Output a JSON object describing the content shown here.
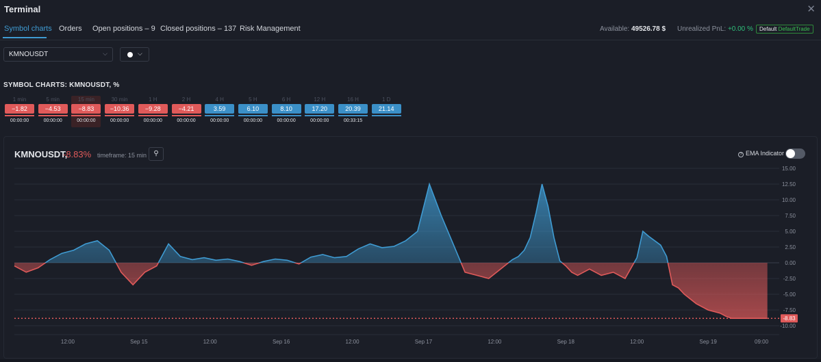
{
  "window": {
    "title": "Terminal",
    "close_icon": "close-icon"
  },
  "tabs": [
    {
      "label": "Symbol charts"
    },
    {
      "label": "Orders"
    },
    {
      "label": "Open positions – 9"
    },
    {
      "label": "Closed positions – 137"
    },
    {
      "label": "Risk Management"
    }
  ],
  "account": {
    "available_label": "Available:",
    "available_value": "49526.78 $",
    "pnl_label": "Unrealized PnL:",
    "pnl_value": "+0.00 %",
    "badge_prefix": "Default",
    "badge_name": "DefaultTrade"
  },
  "symbol_select": {
    "value": "KMNOUSDT"
  },
  "color_select": {
    "value": "white"
  },
  "section_title": "SYMBOL CHARTS: KMNOUSDT, %",
  "timeframes": [
    {
      "label": "1 min",
      "value": "−1.82",
      "time": "00:00:00",
      "sign": "neg"
    },
    {
      "label": "5 min",
      "value": "−4.53",
      "time": "00:00:00",
      "sign": "neg"
    },
    {
      "label": "15 min",
      "value": "−8.83",
      "time": "00:00:00",
      "sign": "neg",
      "selected": true
    },
    {
      "label": "30 min",
      "value": "−10.36",
      "time": "00:00:00",
      "sign": "neg"
    },
    {
      "label": "1 H",
      "value": "−9.28",
      "time": "00:00:00",
      "sign": "neg"
    },
    {
      "label": "2 H",
      "value": "−4.21",
      "time": "00:00:00",
      "sign": "neg"
    },
    {
      "label": "4 H",
      "value": "3.59",
      "time": "00:00:00",
      "sign": "pos"
    },
    {
      "label": "5 H",
      "value": "6.10",
      "time": "00:00:00",
      "sign": "pos"
    },
    {
      "label": "6 H",
      "value": "8.10",
      "time": "00:00:00",
      "sign": "pos"
    },
    {
      "label": "12 H",
      "value": "17.20",
      "time": "00:00:00",
      "sign": "pos"
    },
    {
      "label": "16 H",
      "value": "20.39",
      "time": "00:33:15",
      "sign": "pos"
    },
    {
      "label": "1 D",
      "value": "21.14",
      "time": "",
      "sign": "pos"
    }
  ],
  "chart_header": {
    "symbol": "KMNOUSDT,",
    "change": "-8.83%",
    "timeframe": "timeframe: 15 min",
    "pin_icon": "pin-icon",
    "ema_label": "EMA Indicator",
    "ema_enabled": false
  },
  "colors": {
    "up": "#3f9bd2",
    "down": "#e05a5a",
    "accent": "#3f9bd2",
    "background": "#1b1e27"
  },
  "chart_data": {
    "type": "area",
    "y_ticks": [
      "15.00",
      "12.50",
      "10.00",
      "7.50",
      "5.00",
      "2.50",
      "0.00",
      "-2.50",
      "-5.00",
      "-7.50",
      "-10.00"
    ],
    "ylim": [
      -10,
      15
    ],
    "x_ticks": [
      "12:00",
      "Sep 15",
      "12:00",
      "Sep 16",
      "12:00",
      "Sep 17",
      "12:00",
      "Sep 18",
      "12:00",
      "Sep 19",
      "09:00"
    ],
    "x_tick_hours": [
      12,
      24,
      36,
      48,
      60,
      72,
      84,
      96,
      108,
      120,
      129
    ],
    "xlim_hours": [
      3,
      132
    ],
    "baseline": 0,
    "current_value_label": "-8.83",
    "current_value": -8.83,
    "grid": true,
    "series": [
      {
        "x": [
          3,
          5,
          7,
          9,
          11,
          13,
          15,
          17,
          19,
          21,
          23,
          25,
          27,
          29,
          31,
          33,
          35,
          37,
          39,
          41,
          43,
          45,
          47,
          49,
          51,
          53,
          55,
          57,
          59,
          61,
          63,
          65,
          67,
          69,
          71,
          73,
          75,
          77,
          79,
          81,
          83,
          85,
          87,
          88,
          89,
          90,
          91,
          92,
          93,
          94,
          95,
          96,
          97,
          98,
          100,
          102,
          104,
          106,
          108,
          109,
          110,
          111,
          112,
          113,
          114,
          115,
          116,
          118,
          120,
          122,
          123,
          124,
          125,
          126,
          127,
          127.5,
          128,
          128.5,
          129,
          129.5,
          130
        ],
        "values": [
          -0.5,
          -1.5,
          -0.8,
          0.5,
          1.5,
          2.0,
          3.0,
          3.5,
          2.0,
          -1.5,
          -3.5,
          -1.5,
          -0.5,
          3.0,
          1.0,
          0.5,
          0.8,
          0.4,
          0.6,
          0.2,
          -0.4,
          0.2,
          0.6,
          0.4,
          -0.2,
          0.9,
          1.3,
          0.8,
          1.0,
          2.2,
          3.0,
          2.4,
          2.6,
          3.5,
          5.0,
          12.5,
          7.5,
          3.0,
          -1.5,
          -2.0,
          -2.5,
          -1.0,
          0.5,
          1.0,
          2.0,
          4.0,
          8.0,
          12.5,
          9.0,
          4.0,
          0.3,
          -0.5,
          -1.5,
          -2.0,
          -1.0,
          -2.0,
          -1.5,
          -2.5,
          0.8,
          5.0,
          4.2,
          3.5,
          2.8,
          1.0,
          -3.5,
          -4.0,
          -5.0,
          -6.5,
          -7.5,
          -8.0,
          -8.5,
          -8.83,
          -8.83,
          -8.83,
          -8.83,
          -8.83,
          -8.83,
          -8.83,
          -8.83,
          -8.83,
          -8.83
        ]
      }
    ]
  }
}
